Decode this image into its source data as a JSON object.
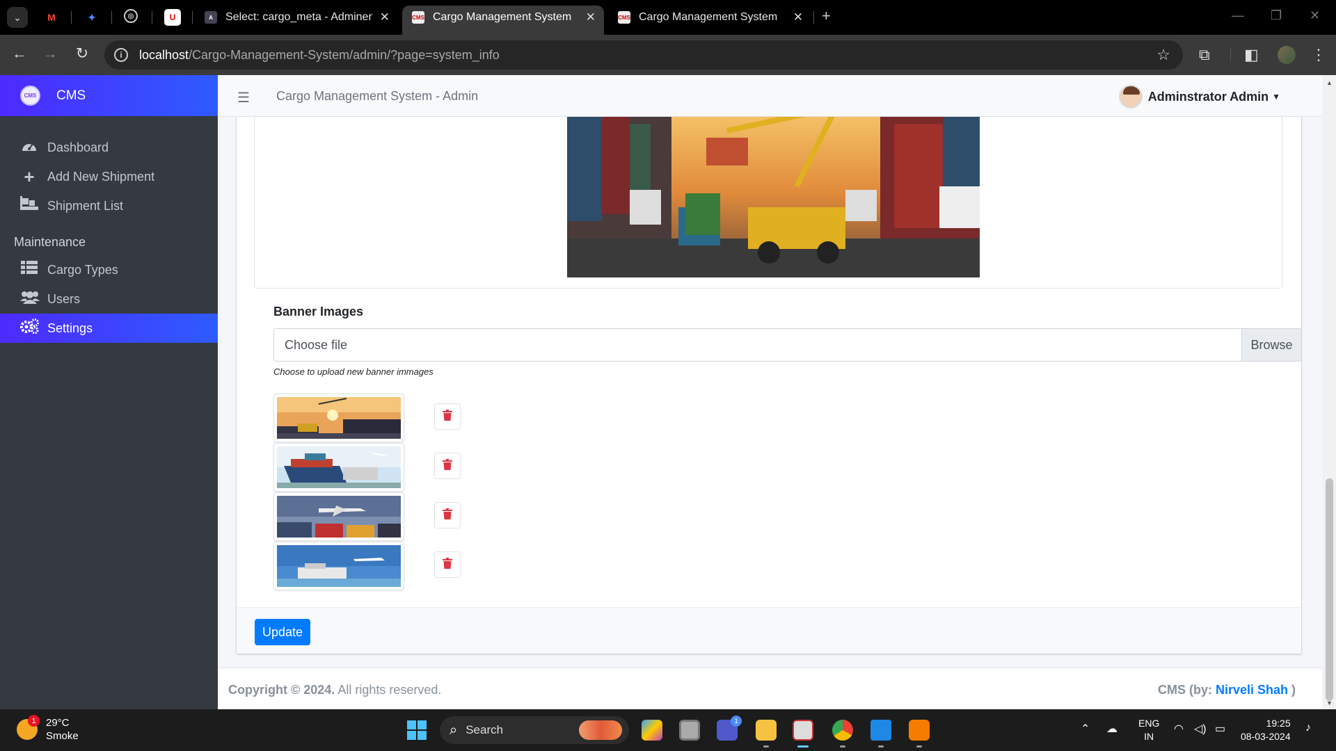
{
  "browser": {
    "tabs": [
      {
        "title": "Select: cargo_meta - Adminer",
        "active": false
      },
      {
        "title": "Cargo Management System",
        "active": true
      },
      {
        "title": "Cargo Management System",
        "active": false
      }
    ],
    "url_host": "localhost",
    "url_path": "/Cargo-Management-System/admin/?page=system_info"
  },
  "sidebar": {
    "brand": "CMS",
    "logo_text": "CMS",
    "items": [
      {
        "label": "Dashboard",
        "icon": "tachometer-icon"
      },
      {
        "label": "Add New Shipment",
        "icon": "plus-icon"
      },
      {
        "label": "Shipment List",
        "icon": "boxes-icon"
      }
    ],
    "section_header": "Maintenance",
    "maintenance_items": [
      {
        "label": "Cargo Types",
        "icon": "table-list-icon"
      },
      {
        "label": "Users",
        "icon": "users-icon"
      },
      {
        "label": "Settings",
        "icon": "cogs-icon",
        "active": true
      }
    ]
  },
  "topnav": {
    "title": "Cargo Management System - Admin",
    "user": "Adminstrator Admin"
  },
  "form": {
    "banner_label": "Banner Images",
    "file_placeholder": "Choose file",
    "browse_label": "Browse",
    "help_text": "Choose to upload new banner immages",
    "banner_count": 4,
    "update_label": "Update"
  },
  "footer": {
    "copyright_bold": "Copyright © 2024.",
    "copyright_rest": " All rights reserved.",
    "credit_prefix": "CMS (by: ",
    "credit_name": "Nirveli Shah",
    "credit_suffix": " )"
  },
  "taskbar": {
    "temperature": "29°C",
    "weather": "Smoke",
    "weather_badge": "1",
    "search_label": "Search",
    "lang_1": "ENG",
    "lang_2": "IN",
    "time": "19:25",
    "date": "08-03-2024"
  },
  "colors": {
    "accent": "#2e5bff",
    "sidebar_bg": "#343a40",
    "danger": "#dc3545",
    "primary": "#007bff"
  }
}
